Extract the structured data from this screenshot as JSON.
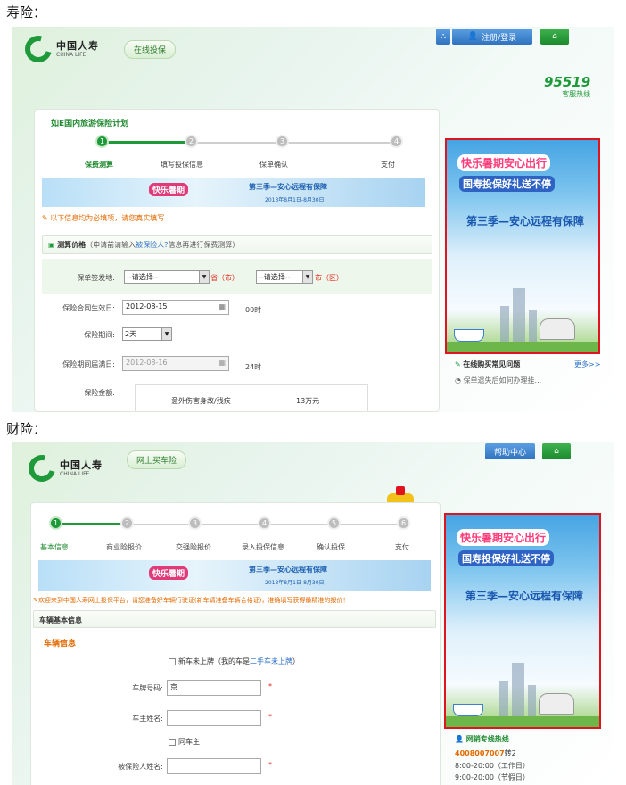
{
  "section1": {
    "heading": "寿险：",
    "logo_cn": "中国人寿",
    "logo_en": "CHINA LIFE",
    "pill": "在线投保",
    "register_label": "注册/登录",
    "hotline_number": "95519",
    "hotline_label": "客服热线",
    "plan_title": "如E国内旅游保险计划",
    "steps": [
      {
        "num": "1",
        "label": "保费测算"
      },
      {
        "num": "2",
        "label": "填写投保信息"
      },
      {
        "num": "3",
        "label": "保单确认"
      },
      {
        "num": "4",
        "label": "支付"
      }
    ],
    "banner_text1": "快乐暑期",
    "banner_text2": "第三季—安心远程有保障",
    "banner_text3": "2013年8月1日-8月30日",
    "warning": "以下信息均为必填项，请您真实填写",
    "calc_label": "测算价格",
    "calc_note_pre": "（申请前请输入",
    "calc_note_link": "被保险人",
    "calc_note_post": "信息再进行保费测算）",
    "form": {
      "place_label": "保单签发地:",
      "province_select": "--请选择--",
      "province_unit": "省（市）",
      "city_select": "--请选择--",
      "city_unit": "市（区）",
      "start_label": "保险合同生效日:",
      "start_value": "2012-08-15",
      "start_time": "00时",
      "period_label": "保险期间:",
      "period_value": "2天",
      "end_label": "保险期间届满日:",
      "end_value": "2012-08-16",
      "end_time": "24时",
      "amount_label": "保险金额:",
      "amount_item": "意外伤害身故/残疾",
      "amount_value": "13万元"
    },
    "ad": {
      "line1": "快乐暑期安心出行",
      "line2": "国寿投保好礼送不停",
      "line3": "第三季—安心远程有保障"
    },
    "faq_title": "在线购买常见问题",
    "faq_more": "更多>>",
    "faq_item": "保单遗失后如何办理挂..."
  },
  "section2": {
    "heading": "财险：",
    "logo_cn": "中国人寿",
    "logo_en": "CHINA LIFE",
    "pill": "网上买车险",
    "help_label": "帮助中心",
    "steps": [
      {
        "num": "1",
        "label": "基本信息"
      },
      {
        "num": "2",
        "label": "商业险报价"
      },
      {
        "num": "3",
        "label": "交强险报价"
      },
      {
        "num": "4",
        "label": "录入投保信息"
      },
      {
        "num": "5",
        "label": "确认投保"
      },
      {
        "num": "6",
        "label": "支付"
      }
    ],
    "warning": "欢迎来到中国人寿网上投保平台，请您准备好车辆行驶证(新车请准备车辆合格证)，准确填写获得最精准的报价！",
    "section_title": "车辆基本信息",
    "vehicle_info": "车辆信息",
    "newcar_pre": "新车未上牌（我的车是",
    "newcar_link": "二手车未上牌",
    "newcar_post": "）",
    "plate_label": "车牌号码:",
    "plate_value": "京",
    "owner_label": "车主姓名:",
    "same_owner": "同车主",
    "insured_label": "被保险人姓名:",
    "ad": {
      "line1": "快乐暑期安心出行",
      "line2": "国寿投保好礼送不停",
      "line3": "第三季—安心远程有保障"
    },
    "hotline_title": "网销专线热线",
    "hotline_number": "4008007007",
    "hotline_ext": "转2",
    "hours1": "8:00-20:00（工作日）",
    "hours2": "9:00-20:00（节假日）"
  },
  "colors": {
    "brand_green": "#1f9a3a",
    "warning_orange": "#e36a00",
    "ad_border": "#e0141e"
  }
}
